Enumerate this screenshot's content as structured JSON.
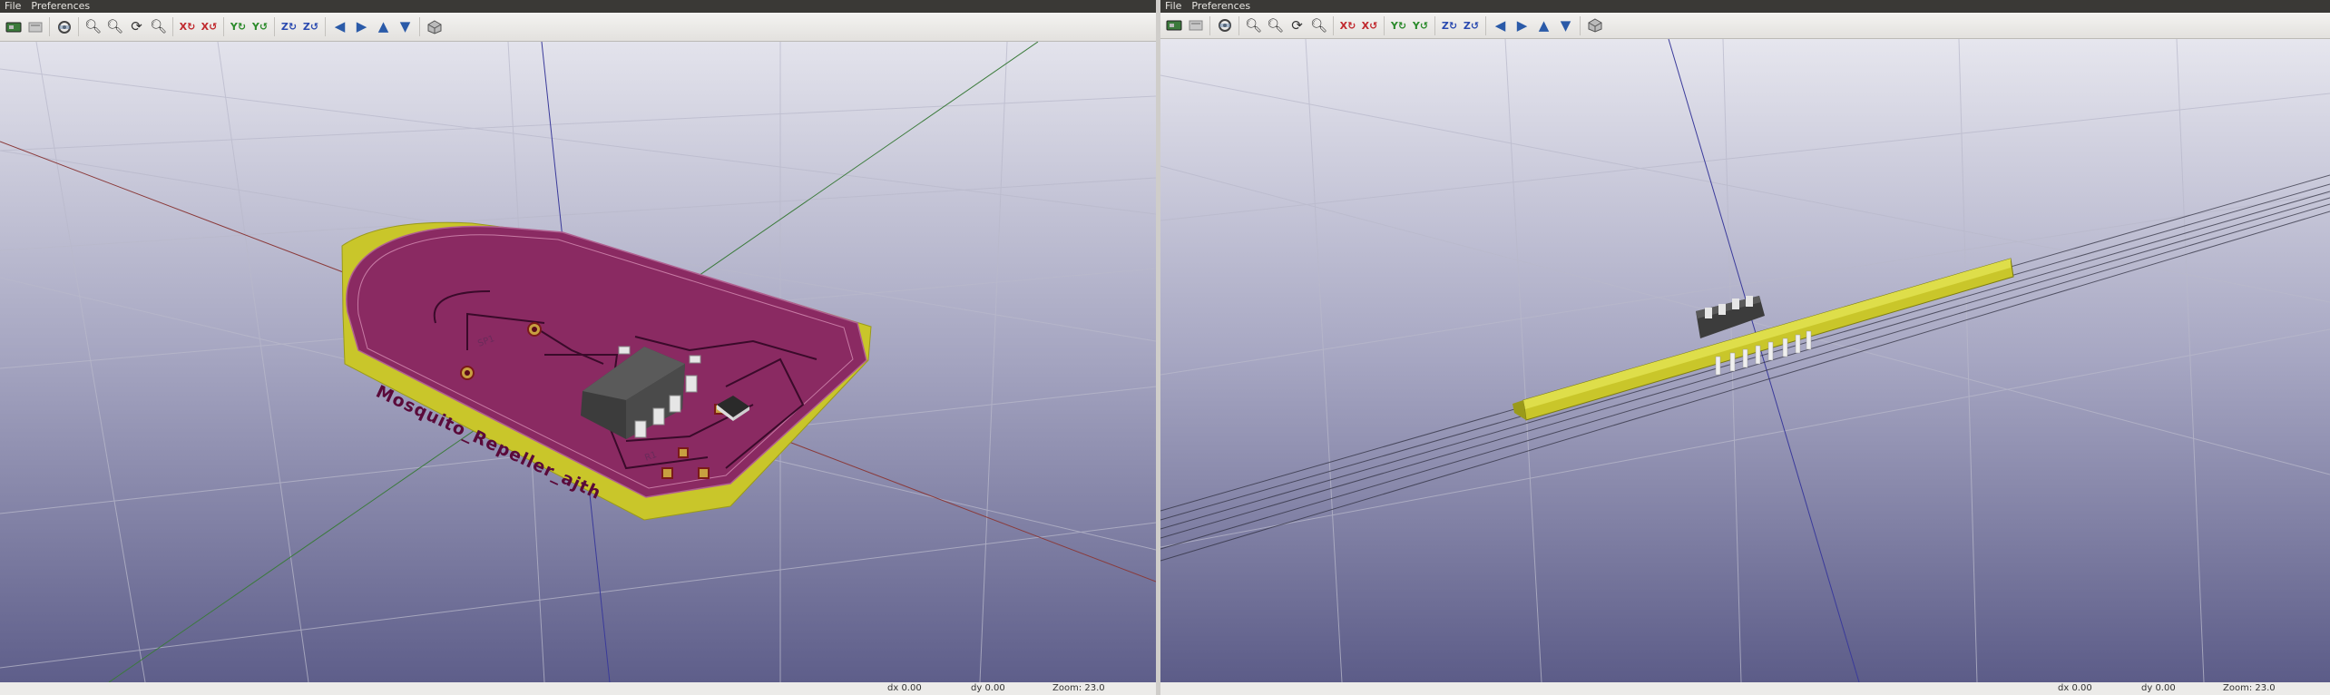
{
  "windows": [
    {
      "menu": [
        "File",
        "Preferences"
      ],
      "toolbar_icons": [
        "board-view-icon",
        "settings-icon",
        "render-options-icon",
        "zoom-in-icon",
        "zoom-out-icon",
        "redraw-icon",
        "zoom-fit-icon",
        "rotate-x-cw-icon",
        "rotate-x-ccw-icon",
        "rotate-y-cw-icon",
        "rotate-y-ccw-icon",
        "rotate-z-cw-icon",
        "rotate-z-ccw-icon",
        "move-left-icon",
        "move-right-icon",
        "move-up-icon",
        "move-down-icon",
        "projection-icon"
      ],
      "board_text": "Mosquito_Repeller_ajth",
      "status": {
        "dx": "dx 0.00",
        "dy": "dy 0.00",
        "zoom": "Zoom: 23.0"
      }
    },
    {
      "menu": [
        "File",
        "Preferences"
      ],
      "toolbar_icons": [
        "board-view-icon",
        "settings-icon",
        "render-options-icon",
        "zoom-in-icon",
        "zoom-out-icon",
        "redraw-icon",
        "zoom-fit-icon",
        "rotate-x-cw-icon",
        "rotate-x-ccw-icon",
        "rotate-y-cw-icon",
        "rotate-y-ccw-icon",
        "rotate-z-cw-icon",
        "rotate-z-ccw-icon",
        "move-left-icon",
        "move-right-icon",
        "move-up-icon",
        "move-down-icon",
        "projection-icon"
      ],
      "status": {
        "dx": "dx 0.00",
        "dy": "dy 0.00",
        "zoom": "Zoom: 23.0"
      }
    }
  ],
  "colors": {
    "menubar": "#3a3936",
    "background_top": "#e2e2ec",
    "background_bottom": "#5c5c88",
    "board_solder_mask": "#8a2a62",
    "board_edge": "#c9c62a",
    "ic_body": "#4a4a4a",
    "axis_x": "#8a3a3a",
    "axis_y": "#3a7a3a",
    "axis_z": "#3a3a9a"
  }
}
